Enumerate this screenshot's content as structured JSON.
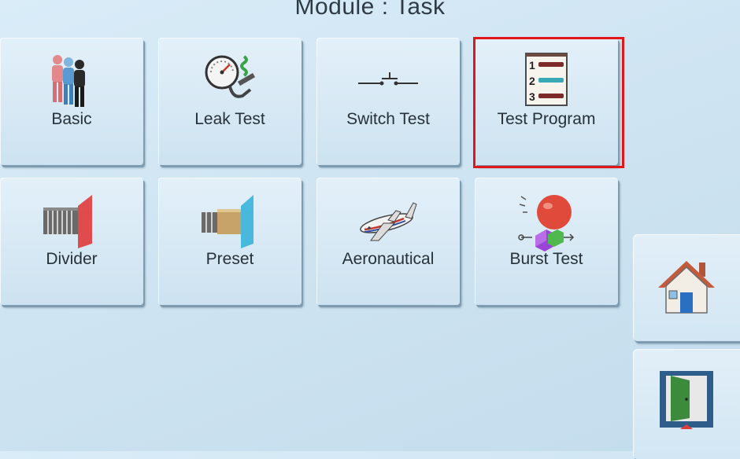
{
  "header": {
    "title": "Module : Task"
  },
  "tiles": [
    {
      "label": "Basic",
      "icon": "people-icon"
    },
    {
      "label": "Leak Test",
      "icon": "pressure-gauge-icon"
    },
    {
      "label": "Switch Test",
      "icon": "switch-icon"
    },
    {
      "label": "Test Program",
      "icon": "numbered-list-icon",
      "selected": true
    },
    {
      "label": "Divider",
      "icon": "divider-icon"
    },
    {
      "label": "Preset",
      "icon": "preset-icon"
    },
    {
      "label": "Aeronautical",
      "icon": "airplane-icon"
    },
    {
      "label": "Burst Test",
      "icon": "balloon-icon"
    }
  ],
  "side": [
    {
      "icon": "home-icon"
    },
    {
      "icon": "exit-door-icon"
    }
  ],
  "colors": {
    "selection": "#e0161b",
    "background": "#d0e5f3",
    "text": "#26313a"
  }
}
